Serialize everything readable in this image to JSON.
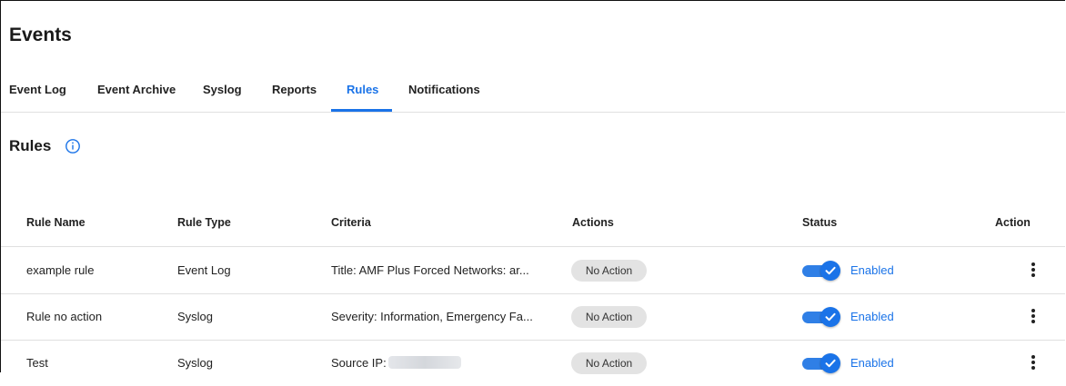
{
  "page": {
    "title": "Events"
  },
  "tabs": [
    {
      "label": "Event Log",
      "active": false
    },
    {
      "label": "Event Archive",
      "active": false
    },
    {
      "label": "Syslog",
      "active": false
    },
    {
      "label": "Reports",
      "active": false
    },
    {
      "label": "Rules",
      "active": true
    },
    {
      "label": "Notifications",
      "active": false
    }
  ],
  "section": {
    "title": "Rules",
    "info_icon": "info-circle-icon"
  },
  "table": {
    "columns": [
      "Rule Name",
      "Rule Type",
      "Criteria",
      "Actions",
      "Status",
      "Action"
    ],
    "rows": [
      {
        "name": "example rule",
        "type": "Event Log",
        "criteria": "Title: AMF Plus Forced Networks: ar...",
        "actions": "No Action",
        "status": "Enabled",
        "enabled": true
      },
      {
        "name": "Rule no action",
        "type": "Syslog",
        "criteria": "Severity: Information, Emergency Fa...",
        "actions": "No Action",
        "status": "Enabled",
        "enabled": true
      },
      {
        "name": "Test",
        "type": "Syslog",
        "criteria": "Source IP:",
        "actions": "No Action",
        "status": "Enabled",
        "enabled": true
      }
    ]
  },
  "colors": {
    "accent": "#1a73e8",
    "chip_bg": "#e3e3e3",
    "divider": "#e0e0e0"
  }
}
